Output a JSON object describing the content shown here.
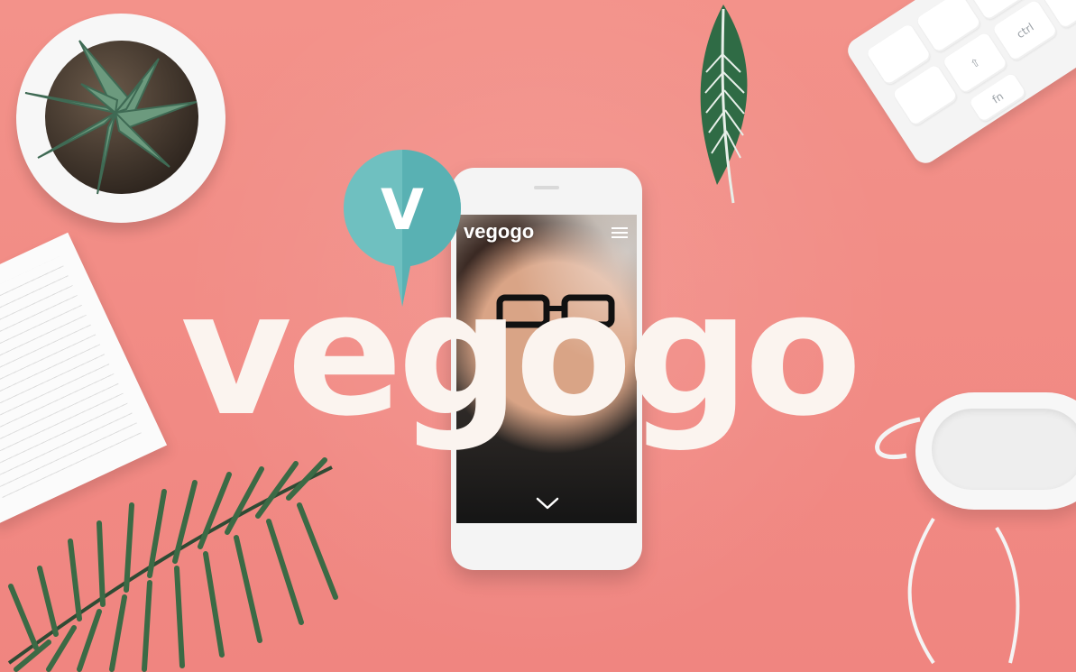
{
  "brand": {
    "name": "vegogo",
    "badge_letter": "V"
  },
  "phone_screen": {
    "logo": "vegogo"
  },
  "keyboard": {
    "keys": [
      {
        "label": "fn"
      },
      {
        "label": "ctrl"
      },
      {
        "label": "⇧"
      }
    ]
  },
  "colors": {
    "background": "#f28a82",
    "logo_text": "#fbf4ef",
    "badge": "#6fc0c0",
    "badge_dark": "#56aeb0"
  },
  "icons": {
    "menu": "hamburger-menu-icon",
    "scroll": "chevron-down-icon",
    "pin": "map-pin-icon"
  }
}
